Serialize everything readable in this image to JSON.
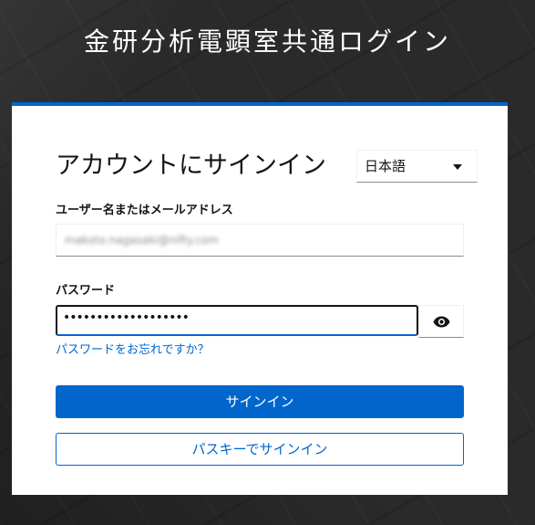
{
  "page": {
    "title": "金研分析電顕室共通ログイン"
  },
  "login": {
    "heading": "アカウントにサインイン",
    "language": {
      "selected": "日本語"
    },
    "username": {
      "label": "ユーザー名またはメールアドレス",
      "value": "makoto.nagasaki@nifty.com"
    },
    "password": {
      "label": "パスワード",
      "masked_value": "•••••••••••••••••••"
    },
    "forgot_password": "パスワードをお忘れですか？",
    "signin_button": "サインイン",
    "passkey_button": "パスキーでサインイン"
  },
  "colors": {
    "accent": "#0066cc",
    "background": "#2a2a2a",
    "card": "#ffffff",
    "text": "#151515"
  },
  "icons": {
    "language_caret": "caret-down-icon",
    "show_password": "eye-icon"
  }
}
